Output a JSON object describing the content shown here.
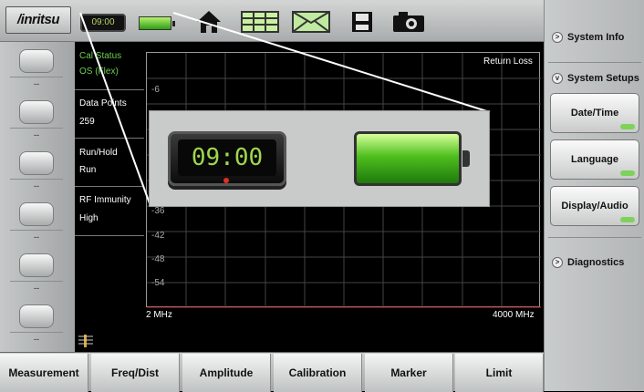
{
  "brand": "/inritsu",
  "topbar": {
    "clock": "09:00",
    "icons": [
      "clock-icon",
      "battery-icon",
      "home-icon",
      "grid-icon",
      "envelope-icon",
      "save-icon",
      "camera-icon"
    ]
  },
  "left_softkeys": [
    "--",
    "--",
    "--",
    "--",
    "--",
    "--"
  ],
  "info_panel": {
    "cal_status_label": "Cal Status",
    "cal_status_value": "OS (Flex)",
    "data_points_label": "Data Points",
    "data_points_value": "259",
    "run_hold_label": "Run/Hold",
    "run_hold_value": "Run",
    "rf_immunity_label": "RF Immunity",
    "rf_immunity_value": "High"
  },
  "plot": {
    "title": "Return Loss",
    "x_start": "2 MHz",
    "x_stop": "4000 MHz",
    "y_ticks": [
      "-6",
      "-36",
      "-42",
      "-48",
      "-54"
    ]
  },
  "zoom_callout": {
    "clock": "09:00"
  },
  "right_panel": {
    "system_info": "System Info",
    "system_setups": "System Setups",
    "buttons": [
      "Date/Time",
      "Language",
      "Display/Audio"
    ],
    "diagnostics": "Diagnostics"
  },
  "bottom_tabs": [
    "Measurement",
    "Freq/Dist",
    "Amplitude",
    "Calibration",
    "Marker",
    "Limit"
  ],
  "colors": {
    "accent_green": "#6ccf4f",
    "background": "#000000",
    "panel_gray": "#b3b6b6"
  }
}
